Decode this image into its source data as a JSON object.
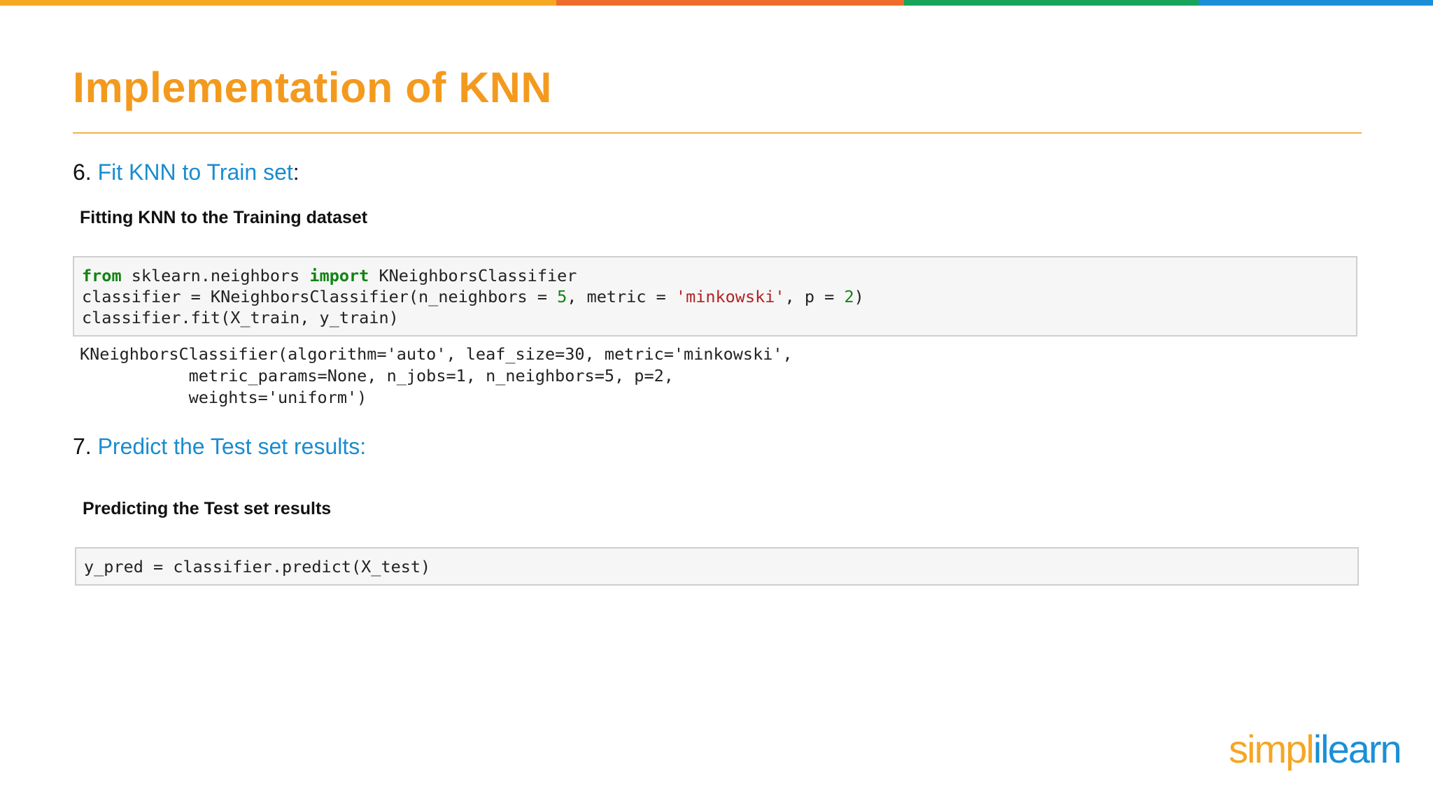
{
  "colors": {
    "accent_orange": "#f39a1e",
    "link_blue": "#1a8ccf",
    "keyword_green": "#128412",
    "string_red": "#b22222"
  },
  "slide": {
    "title": "Implementation of KNN"
  },
  "step6": {
    "number": "6. ",
    "label": "Fit KNN to Train set",
    "suffix": ":",
    "subheading": "Fitting KNN to the Training dataset",
    "code": {
      "line1": {
        "kw1": "from",
        "mod": " sklearn.neighbors ",
        "kw2": "import",
        "name": " KNeighborsClassifier"
      },
      "line2": {
        "a": "classifier = KNeighborsClassifier(n_neighbors = ",
        "n": "5",
        "b": ", metric = ",
        "s": "'minkowski'",
        "c": ", p = ",
        "p": "2",
        "d": ")"
      },
      "line3": "classifier.fit(X_train, y_train)"
    },
    "output": [
      "KNeighborsClassifier(algorithm='auto', leaf_size=30, metric='minkowski',",
      "           metric_params=None, n_jobs=1, n_neighbors=5, p=2,",
      "           weights='uniform')"
    ]
  },
  "step7": {
    "number": "7. ",
    "label": "Predict the Test set results:",
    "subheading": "Predicting the Test set results",
    "code": "y_pred = classifier.predict(X_test)"
  },
  "logo": {
    "part1": "simpl",
    "part2": "ilearn"
  }
}
